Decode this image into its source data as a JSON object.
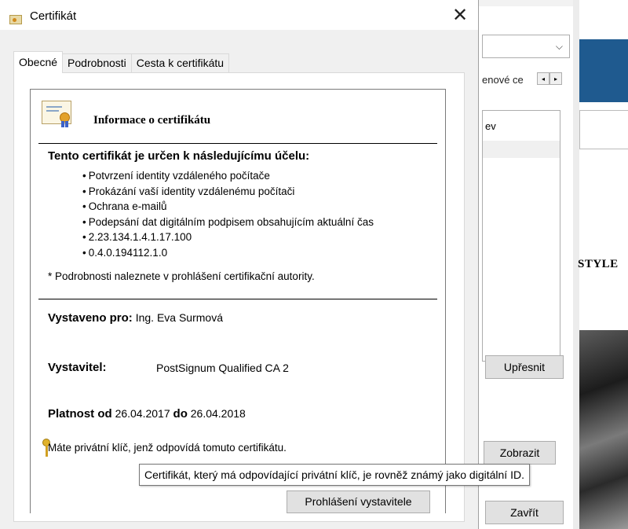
{
  "dialog": {
    "title": "Certifikát",
    "close_glyph": "✕",
    "tabs": [
      "Obecné",
      "Podrobnosti",
      "Cesta k certifikátu"
    ],
    "info": {
      "heading": "Informace o certifikátu",
      "purpose_title": "Tento certifikát je určen k následujícímu účelu:",
      "purposes": [
        "Potvrzení identity vzdáleného počítače",
        "Prokázání vaší identity vzdálenému počítači",
        "Ochrana e-mailů",
        "Podepsání dat digitálním podpisem obsahujícím aktuální čas",
        "2.23.134.1.4.1.17.100",
        "0.4.0.194112.1.0"
      ],
      "note": "* Podrobnosti naleznete v prohlášení certifikační autority.",
      "issued_to_label": "Vystaveno pro:",
      "issued_to_value": "Ing. Eva Surmová",
      "issuer_label": "Vystavitel:",
      "issuer_value": "PostSignum Qualified CA 2",
      "validity_from_label": "Platnost od",
      "validity_from": "26.04.2017",
      "validity_to_label": "do",
      "validity_to": "26.04.2018",
      "private_key_text": "Máte privátní klíč, jenž odpovídá tomuto certifikátu."
    },
    "issuer_statement_button": "Prohlášení vystavitele"
  },
  "tooltip": "Certifikát, který má odpovídající privátní klíč, je rovněž známý jako digitální ID.",
  "background": {
    "tab_partial": "enové ce",
    "arrow_left": "◂",
    "arrow_right": "▸",
    "dropdown_chevron": "⌵",
    "list_partial": "ev",
    "upresnit_button": "Upřesnit",
    "zobrazit_button": "Zobrazit",
    "zavrit_button": "Zavřít",
    "style_text": "STYLE"
  },
  "colors": {
    "dialog_bg": "#f0f0f0",
    "panel_bg": "#ffffff",
    "button_bg": "#e1e1e1",
    "accent_blue": "#1f5a8f"
  }
}
